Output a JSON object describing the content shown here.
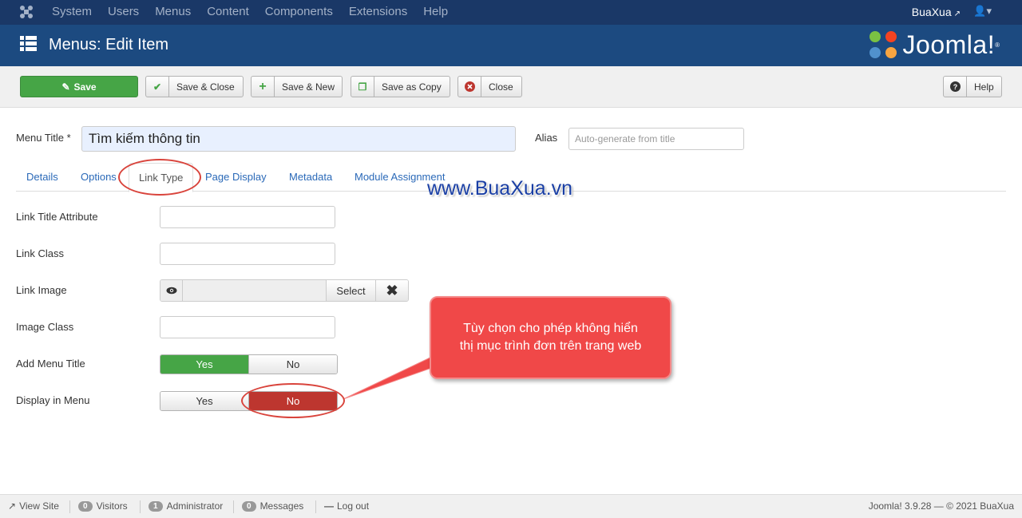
{
  "topnav": {
    "items": [
      "System",
      "Users",
      "Menus",
      "Content",
      "Components",
      "Extensions",
      "Help"
    ],
    "user": "BuaXua"
  },
  "titlebar": {
    "title": "Menus: Edit Item",
    "brand": "Joomla!"
  },
  "toolbar": {
    "save": "Save",
    "save_close": "Save & Close",
    "save_new": "Save & New",
    "save_copy": "Save as Copy",
    "close": "Close",
    "help": "Help"
  },
  "form": {
    "menu_title_label": "Menu Title *",
    "menu_title_value": "Tìm kiếm thông tin",
    "alias_label": "Alias",
    "alias_placeholder": "Auto-generate from title"
  },
  "tabs": [
    "Details",
    "Options",
    "Link Type",
    "Page Display",
    "Metadata",
    "Module Assignment"
  ],
  "active_tab": "Link Type",
  "watermark": "www.BuaXua.vn",
  "fields": {
    "link_title_attr": "Link Title Attribute",
    "link_class": "Link Class",
    "link_image": "Link Image",
    "select_label": "Select",
    "image_class": "Image Class",
    "add_menu_title": "Add Menu Title",
    "display_in_menu": "Display in Menu",
    "yes": "Yes",
    "no": "No"
  },
  "add_menu_title_value": "Yes",
  "display_in_menu_value": "No",
  "callout": {
    "line1": "Tùy chọn cho phép không hiển",
    "line2": "thị mục trình đơn trên trang web"
  },
  "statusbar": {
    "view_site": "View Site",
    "visitors_count": "0",
    "visitors": "Visitors",
    "admin_count": "1",
    "administrator": "Administrator",
    "messages_count": "0",
    "messages": "Messages",
    "logout": "Log out",
    "version": "Joomla! 3.9.28 — © 2021 BuaXua"
  },
  "colors": {
    "topnav": "#1a3867",
    "titlebar": "#1c4a80",
    "save_green": "#46a546",
    "no_red": "#bd362f",
    "link": "#2a69b8",
    "callout": "#f04848"
  }
}
